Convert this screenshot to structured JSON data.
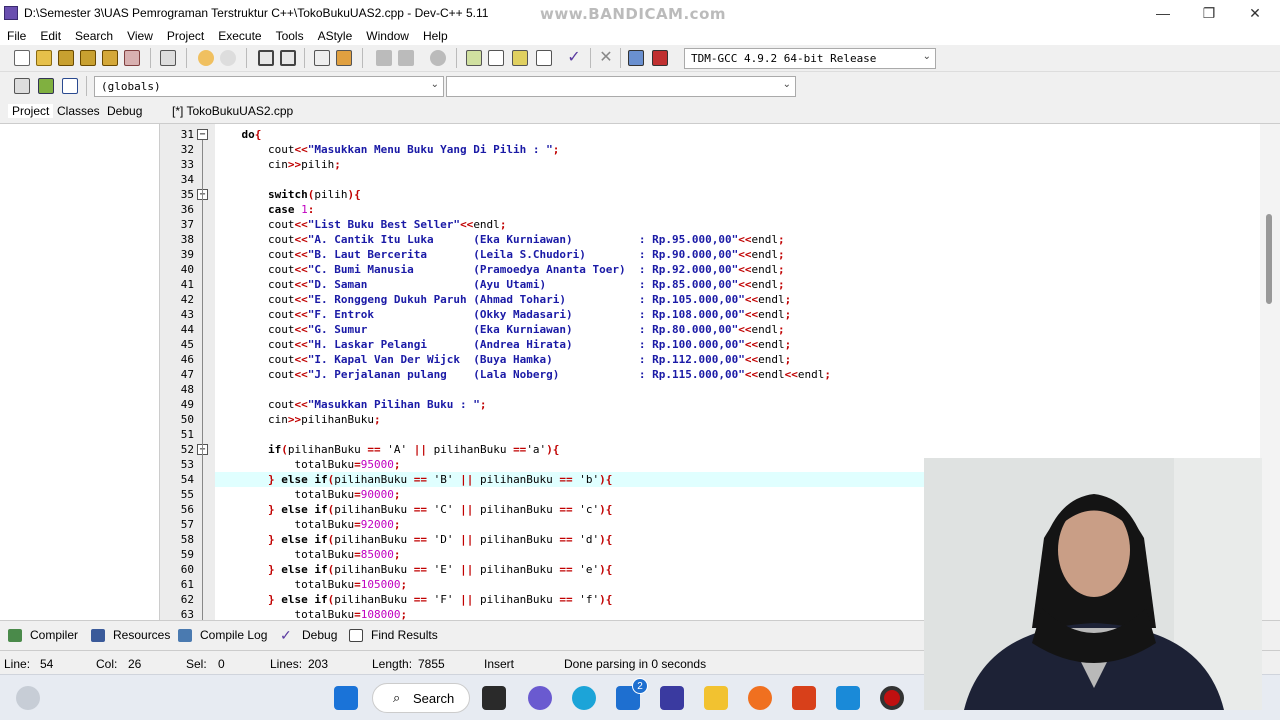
{
  "window": {
    "title": "D:\\Semester 3\\UAS Pemrograman Terstruktur C++\\TokoBukuUAS2.cpp - Dev-C++ 5.11",
    "watermark": "www.BANDICAM.com",
    "minimize": "—",
    "maximize": "❐",
    "close": "✕"
  },
  "menu": [
    "File",
    "Edit",
    "Search",
    "View",
    "Project",
    "Execute",
    "Tools",
    "AStyle",
    "Window",
    "Help"
  ],
  "toolbar": {
    "compiler_select": "TDM-GCC 4.9.2 64-bit Release",
    "globals_select": "(globals)",
    "function_select": ""
  },
  "left_tabs": [
    "Project",
    "Classes",
    "Debug"
  ],
  "editor_tab": "[*] TokoBukuUAS2.cpp",
  "code_lines": [
    {
      "n": "31",
      "fold": "−",
      "t": [
        [
          "    ",
          "id"
        ],
        [
          "do",
          "kw"
        ],
        [
          "{",
          "op"
        ]
      ]
    },
    {
      "n": "32",
      "t": [
        [
          "        cout",
          "id"
        ],
        [
          "<<",
          "op"
        ],
        [
          "\"Masukkan Menu Buku Yang Di Pilih : \"",
          "st"
        ],
        [
          ";",
          "op"
        ]
      ]
    },
    {
      "n": "33",
      "t": [
        [
          "        cin",
          "id"
        ],
        [
          ">>",
          "op"
        ],
        [
          "pilih",
          "id"
        ],
        [
          ";",
          "op"
        ]
      ]
    },
    {
      "n": "34",
      "t": []
    },
    {
      "n": "35",
      "fold": "−",
      "t": [
        [
          "        ",
          "id"
        ],
        [
          "switch",
          "kw"
        ],
        [
          "(",
          "op"
        ],
        [
          "pilih",
          "id"
        ],
        [
          "){",
          "op"
        ]
      ]
    },
    {
      "n": "36",
      "t": [
        [
          "        ",
          "id"
        ],
        [
          "case",
          "kw"
        ],
        [
          " ",
          "id"
        ],
        [
          "1",
          "nu"
        ],
        [
          ":",
          "op"
        ]
      ]
    },
    {
      "n": "37",
      "t": [
        [
          "        cout",
          "id"
        ],
        [
          "<<",
          "op"
        ],
        [
          "\"List Buku Best Seller\"",
          "st"
        ],
        [
          "<<",
          "op"
        ],
        [
          "endl",
          "id"
        ],
        [
          ";",
          "op"
        ]
      ]
    },
    {
      "n": "38",
      "t": [
        [
          "        cout",
          "id"
        ],
        [
          "<<",
          "op"
        ],
        [
          "\"A. Cantik Itu Luka      (Eka Kurniawan)          : Rp.95.000,00\"",
          "st"
        ],
        [
          "<<",
          "op"
        ],
        [
          "endl",
          "id"
        ],
        [
          ";",
          "op"
        ]
      ]
    },
    {
      "n": "39",
      "t": [
        [
          "        cout",
          "id"
        ],
        [
          "<<",
          "op"
        ],
        [
          "\"B. Laut Bercerita       (Leila S.Chudori)        : Rp.90.000,00\"",
          "st"
        ],
        [
          "<<",
          "op"
        ],
        [
          "endl",
          "id"
        ],
        [
          ";",
          "op"
        ]
      ]
    },
    {
      "n": "40",
      "t": [
        [
          "        cout",
          "id"
        ],
        [
          "<<",
          "op"
        ],
        [
          "\"C. Bumi Manusia         (Pramoedya Ananta Toer)  : Rp.92.000,00\"",
          "st"
        ],
        [
          "<<",
          "op"
        ],
        [
          "endl",
          "id"
        ],
        [
          ";",
          "op"
        ]
      ]
    },
    {
      "n": "41",
      "t": [
        [
          "        cout",
          "id"
        ],
        [
          "<<",
          "op"
        ],
        [
          "\"D. Saman                (Ayu Utami)              : Rp.85.000,00\"",
          "st"
        ],
        [
          "<<",
          "op"
        ],
        [
          "endl",
          "id"
        ],
        [
          ";",
          "op"
        ]
      ]
    },
    {
      "n": "42",
      "t": [
        [
          "        cout",
          "id"
        ],
        [
          "<<",
          "op"
        ],
        [
          "\"E. Ronggeng Dukuh Paruh (Ahmad Tohari)           : Rp.105.000,00\"",
          "st"
        ],
        [
          "<<",
          "op"
        ],
        [
          "endl",
          "id"
        ],
        [
          ";",
          "op"
        ]
      ]
    },
    {
      "n": "43",
      "t": [
        [
          "        cout",
          "id"
        ],
        [
          "<<",
          "op"
        ],
        [
          "\"F. Entrok               (Okky Madasari)          : Rp.108.000,00\"",
          "st"
        ],
        [
          "<<",
          "op"
        ],
        [
          "endl",
          "id"
        ],
        [
          ";",
          "op"
        ]
      ]
    },
    {
      "n": "44",
      "t": [
        [
          "        cout",
          "id"
        ],
        [
          "<<",
          "op"
        ],
        [
          "\"G. Sumur                (Eka Kurniawan)          : Rp.80.000,00\"",
          "st"
        ],
        [
          "<<",
          "op"
        ],
        [
          "endl",
          "id"
        ],
        [
          ";",
          "op"
        ]
      ]
    },
    {
      "n": "45",
      "t": [
        [
          "        cout",
          "id"
        ],
        [
          "<<",
          "op"
        ],
        [
          "\"H. Laskar Pelangi       (Andrea Hirata)          : Rp.100.000,00\"",
          "st"
        ],
        [
          "<<",
          "op"
        ],
        [
          "endl",
          "id"
        ],
        [
          ";",
          "op"
        ]
      ]
    },
    {
      "n": "46",
      "t": [
        [
          "        cout",
          "id"
        ],
        [
          "<<",
          "op"
        ],
        [
          "\"I. Kapal Van Der Wijck  (Buya Hamka)             : Rp.112.000,00\"",
          "st"
        ],
        [
          "<<",
          "op"
        ],
        [
          "endl",
          "id"
        ],
        [
          ";",
          "op"
        ]
      ]
    },
    {
      "n": "47",
      "t": [
        [
          "        cout",
          "id"
        ],
        [
          "<<",
          "op"
        ],
        [
          "\"J. Perjalanan pulang    (Lala Noberg)            : Rp.115.000,00\"",
          "st"
        ],
        [
          "<<",
          "op"
        ],
        [
          "endl",
          "id"
        ],
        [
          "<<",
          "op"
        ],
        [
          "endl",
          "id"
        ],
        [
          ";",
          "op"
        ]
      ]
    },
    {
      "n": "48",
      "t": []
    },
    {
      "n": "49",
      "t": [
        [
          "        cout",
          "id"
        ],
        [
          "<<",
          "op"
        ],
        [
          "\"Masukkan Pilihan Buku : \"",
          "st"
        ],
        [
          ";",
          "op"
        ]
      ]
    },
    {
      "n": "50",
      "t": [
        [
          "        cin",
          "id"
        ],
        [
          ">>",
          "op"
        ],
        [
          "pilihanBuku",
          "id"
        ],
        [
          ";",
          "op"
        ]
      ]
    },
    {
      "n": "51",
      "t": []
    },
    {
      "n": "52",
      "fold": "−",
      "t": [
        [
          "        ",
          "id"
        ],
        [
          "if",
          "kw"
        ],
        [
          "(",
          "op"
        ],
        [
          "pilihanBuku ",
          "id"
        ],
        [
          "==",
          "op"
        ],
        [
          " 'A' ",
          "id"
        ],
        [
          "||",
          "op"
        ],
        [
          " pilihanBuku ",
          "id"
        ],
        [
          "==",
          "op"
        ],
        [
          "'a'",
          "id"
        ],
        [
          "){",
          "op"
        ]
      ]
    },
    {
      "n": "53",
      "t": [
        [
          "            totalBuku",
          "id"
        ],
        [
          "=",
          "op"
        ],
        [
          "95000",
          "nu"
        ],
        [
          ";",
          "op"
        ]
      ]
    },
    {
      "n": "54",
      "hl": true,
      "t": [
        [
          "        ",
          "id"
        ],
        [
          "} ",
          "op"
        ],
        [
          "else if",
          "kw"
        ],
        [
          "(",
          "op"
        ],
        [
          "pilihanBuku ",
          "id"
        ],
        [
          "==",
          "op"
        ],
        [
          " 'B' ",
          "id"
        ],
        [
          "||",
          "op"
        ],
        [
          " pilihanBuku ",
          "id"
        ],
        [
          "==",
          "op"
        ],
        [
          " 'b'",
          "id"
        ],
        [
          "){",
          "op"
        ]
      ]
    },
    {
      "n": "55",
      "t": [
        [
          "            totalBuku",
          "id"
        ],
        [
          "=",
          "op"
        ],
        [
          "90000",
          "nu"
        ],
        [
          ";",
          "op"
        ]
      ]
    },
    {
      "n": "56",
      "t": [
        [
          "        ",
          "id"
        ],
        [
          "} ",
          "op"
        ],
        [
          "else if",
          "kw"
        ],
        [
          "(",
          "op"
        ],
        [
          "pilihanBuku ",
          "id"
        ],
        [
          "==",
          "op"
        ],
        [
          " 'C' ",
          "id"
        ],
        [
          "||",
          "op"
        ],
        [
          " pilihanBuku ",
          "id"
        ],
        [
          "==",
          "op"
        ],
        [
          " 'c'",
          "id"
        ],
        [
          "){",
          "op"
        ]
      ]
    },
    {
      "n": "57",
      "t": [
        [
          "            totalBuku",
          "id"
        ],
        [
          "=",
          "op"
        ],
        [
          "92000",
          "nu"
        ],
        [
          ";",
          "op"
        ]
      ]
    },
    {
      "n": "58",
      "t": [
        [
          "        ",
          "id"
        ],
        [
          "} ",
          "op"
        ],
        [
          "else if",
          "kw"
        ],
        [
          "(",
          "op"
        ],
        [
          "pilihanBuku ",
          "id"
        ],
        [
          "==",
          "op"
        ],
        [
          " 'D' ",
          "id"
        ],
        [
          "||",
          "op"
        ],
        [
          " pilihanBuku ",
          "id"
        ],
        [
          "==",
          "op"
        ],
        [
          " 'd'",
          "id"
        ],
        [
          "){",
          "op"
        ]
      ]
    },
    {
      "n": "59",
      "t": [
        [
          "            totalBuku",
          "id"
        ],
        [
          "=",
          "op"
        ],
        [
          "85000",
          "nu"
        ],
        [
          ";",
          "op"
        ]
      ]
    },
    {
      "n": "60",
      "t": [
        [
          "        ",
          "id"
        ],
        [
          "} ",
          "op"
        ],
        [
          "else if",
          "kw"
        ],
        [
          "(",
          "op"
        ],
        [
          "pilihanBuku ",
          "id"
        ],
        [
          "==",
          "op"
        ],
        [
          " 'E' ",
          "id"
        ],
        [
          "||",
          "op"
        ],
        [
          " pilihanBuku ",
          "id"
        ],
        [
          "==",
          "op"
        ],
        [
          " 'e'",
          "id"
        ],
        [
          "){",
          "op"
        ]
      ]
    },
    {
      "n": "61",
      "t": [
        [
          "            totalBuku",
          "id"
        ],
        [
          "=",
          "op"
        ],
        [
          "105000",
          "nu"
        ],
        [
          ";",
          "op"
        ]
      ]
    },
    {
      "n": "62",
      "t": [
        [
          "        ",
          "id"
        ],
        [
          "} ",
          "op"
        ],
        [
          "else if",
          "kw"
        ],
        [
          "(",
          "op"
        ],
        [
          "pilihanBuku ",
          "id"
        ],
        [
          "==",
          "op"
        ],
        [
          " 'F' ",
          "id"
        ],
        [
          "||",
          "op"
        ],
        [
          " pilihanBuku ",
          "id"
        ],
        [
          "==",
          "op"
        ],
        [
          " 'f'",
          "id"
        ],
        [
          "){",
          "op"
        ]
      ]
    },
    {
      "n": "63",
      "t": [
        [
          "            totalBuku",
          "id"
        ],
        [
          "=",
          "op"
        ],
        [
          "108000",
          "nu"
        ],
        [
          ";",
          "op"
        ]
      ]
    }
  ],
  "bottom_tabs": [
    "Compiler",
    "Resources",
    "Compile Log",
    "Debug",
    "Find Results"
  ],
  "status": {
    "line_label": "Line:",
    "line": "54",
    "col_label": "Col:",
    "col": "26",
    "sel_label": "Sel:",
    "sel": "0",
    "lines_label": "Lines:",
    "lines": "203",
    "length_label": "Length:",
    "length": "7855",
    "mode": "Insert",
    "message": "Done parsing in 0 seconds"
  },
  "taskbar": {
    "search_label": "Search",
    "badge": "2"
  },
  "colors": {
    "keyword": "#000000",
    "string": "#1a1aa6",
    "operator": "#c00000",
    "number": "#c000c0",
    "current_line": "#e0ffff"
  }
}
